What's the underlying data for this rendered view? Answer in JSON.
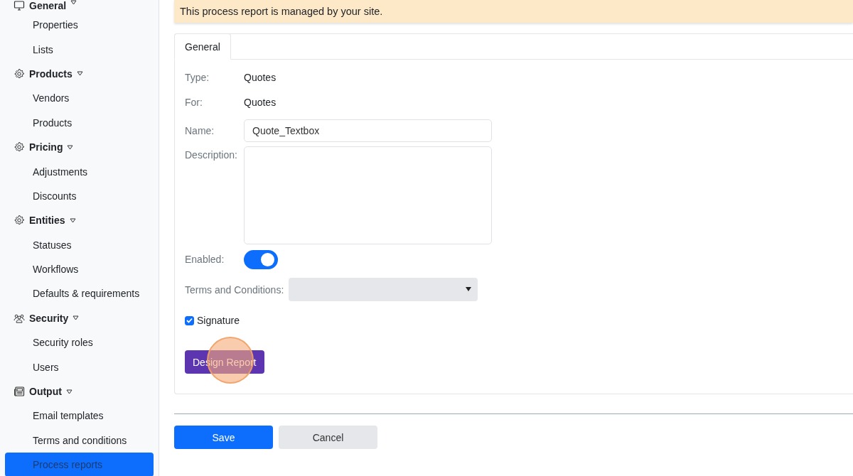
{
  "sidebar": {
    "groups": [
      {
        "label": "General",
        "kind": "monitor",
        "expanded": true,
        "items": [
          {
            "label": "Properties",
            "selected": false
          },
          {
            "label": "Lists",
            "selected": false
          }
        ]
      },
      {
        "label": "Products",
        "kind": "gear",
        "expanded": true,
        "items": [
          {
            "label": "Vendors",
            "selected": false
          },
          {
            "label": "Products",
            "selected": false
          }
        ]
      },
      {
        "label": "Pricing",
        "kind": "gear",
        "expanded": true,
        "items": [
          {
            "label": "Adjustments",
            "selected": false
          },
          {
            "label": "Discounts",
            "selected": false
          }
        ]
      },
      {
        "label": "Entities",
        "kind": "gear",
        "expanded": true,
        "items": [
          {
            "label": "Statuses",
            "selected": false
          },
          {
            "label": "Workflows",
            "selected": false
          },
          {
            "label": "Defaults & requirements",
            "selected": false
          }
        ]
      },
      {
        "label": "Security",
        "kind": "people",
        "expanded": true,
        "items": [
          {
            "label": "Security roles",
            "selected": false
          },
          {
            "label": "Users",
            "selected": false
          }
        ]
      },
      {
        "label": "Output",
        "kind": "newspaper",
        "expanded": true,
        "items": [
          {
            "label": "Email templates",
            "selected": false
          },
          {
            "label": "Terms and conditions",
            "selected": false
          },
          {
            "label": "Process reports",
            "selected": true
          }
        ]
      }
    ]
  },
  "banner": "This process report is managed by your site.",
  "tabs": [
    {
      "label": "General",
      "selected": true
    }
  ],
  "form": {
    "type": {
      "label": "Type:",
      "value": "Quotes"
    },
    "for": {
      "label": "For:",
      "value": "Quotes"
    },
    "name": {
      "label": "Name:",
      "value": "Quote_Textbox"
    },
    "description": {
      "label": "Description:"
    },
    "enabled": {
      "label": "Enabled:",
      "on": true
    },
    "terms": {
      "label": "Terms and Conditions:"
    },
    "signature": {
      "label": "Signature",
      "checked": true
    },
    "design_button": "Design Report"
  },
  "buttons": {
    "save": "Save",
    "cancel": "Cancel"
  }
}
